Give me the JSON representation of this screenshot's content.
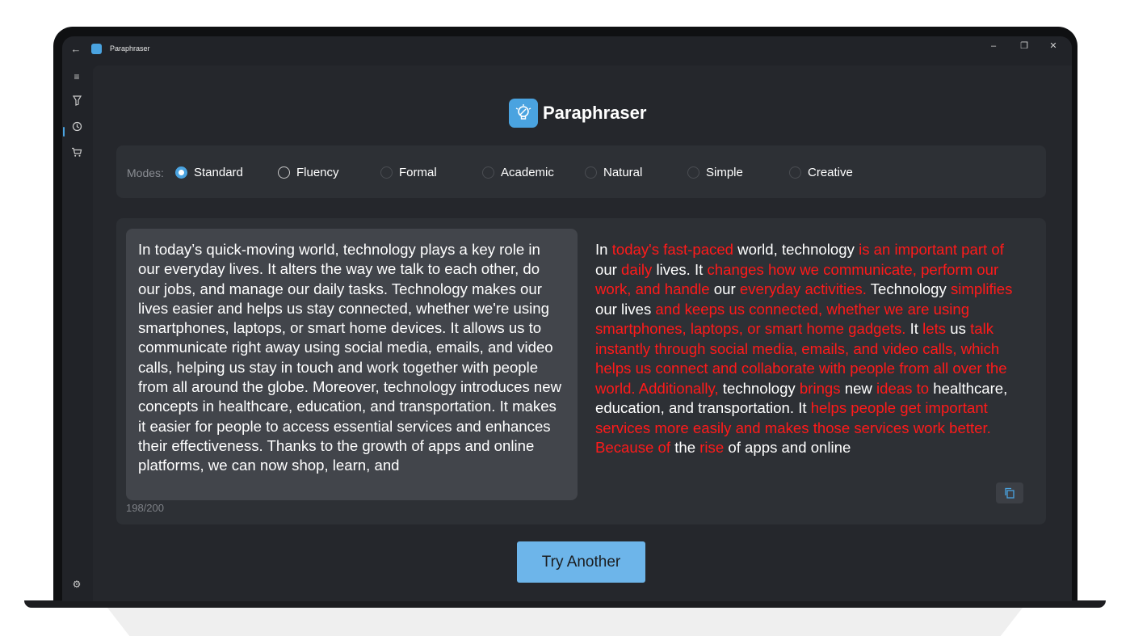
{
  "window": {
    "title": "Paraphraser",
    "back_symbol": "←",
    "minimize_symbol": "–",
    "restore_symbol": "❐",
    "close_symbol": "✕"
  },
  "sidebar": {
    "items": [
      {
        "name": "menu-icon",
        "symbol": "≡"
      },
      {
        "name": "paraphraser-icon",
        "symbol": "🜄"
      },
      {
        "name": "history-icon",
        "symbol": "⟲"
      },
      {
        "name": "cart-icon",
        "symbol": "🛒"
      }
    ],
    "settings_symbol": "⚙"
  },
  "header": {
    "title": "Paraphraser"
  },
  "modes": {
    "label": "Modes:",
    "options": [
      {
        "label": "Standard",
        "selected": true
      },
      {
        "label": "Fluency",
        "selected": false
      },
      {
        "label": "Formal",
        "selected": false
      },
      {
        "label": "Academic",
        "selected": false
      },
      {
        "label": "Natural",
        "selected": false
      },
      {
        "label": "Simple",
        "selected": false
      },
      {
        "label": "Creative",
        "selected": false
      }
    ]
  },
  "input": {
    "text": "In today’s quick-moving world, technology plays a key role in our everyday lives. It alters the way we talk to each other, do our jobs, and manage our daily tasks. Technology makes our lives easier and helps us stay connected, whether we're using smartphones, laptops, or smart home devices. It allows us to communicate right away using social media, emails, and video calls, helping us stay in touch and work together with people from all around the globe. Moreover, technology introduces new concepts in healthcare, education, and transportation. It makes it easier for people to access essential services and enhances their effectiveness. Thanks to the growth of apps and online platforms, we can now shop, learn, and",
    "counter": "198/200"
  },
  "output": {
    "segments": [
      {
        "t": "In ",
        "c": "w"
      },
      {
        "t": "today's fast-paced",
        "c": "r"
      },
      {
        "t": " world, technology ",
        "c": "w"
      },
      {
        "t": "is an important part of",
        "c": "r"
      },
      {
        "t": " our ",
        "c": "w"
      },
      {
        "t": "daily",
        "c": "r"
      },
      {
        "t": " lives. It ",
        "c": "w"
      },
      {
        "t": "changes how we communicate, perform our work, and handle",
        "c": "r"
      },
      {
        "t": " our ",
        "c": "w"
      },
      {
        "t": "everyday activities.",
        "c": "r"
      },
      {
        "t": " Technology ",
        "c": "w"
      },
      {
        "t": "simplifies",
        "c": "r"
      },
      {
        "t": " our lives ",
        "c": "w"
      },
      {
        "t": "and keeps us connected, whether we are using smartphones, laptops, or smart home gadgets.",
        "c": "r"
      },
      {
        "t": " It ",
        "c": "w"
      },
      {
        "t": "lets",
        "c": "r"
      },
      {
        "t": " us ",
        "c": "w"
      },
      {
        "t": "talk instantly through social media, emails, and video calls, which helps us connect and collaborate with people from all over the world. Additionally,",
        "c": "r"
      },
      {
        "t": " technology ",
        "c": "w"
      },
      {
        "t": "brings",
        "c": "r"
      },
      {
        "t": " new ",
        "c": "w"
      },
      {
        "t": "ideas to",
        "c": "r"
      },
      {
        "t": " healthcare, education, and transportation. It ",
        "c": "w"
      },
      {
        "t": "helps people get important services more easily and makes those services work better. Because of",
        "c": "r"
      },
      {
        "t": " the ",
        "c": "w"
      },
      {
        "t": "rise",
        "c": "r"
      },
      {
        "t": " of apps and online",
        "c": "w"
      }
    ]
  },
  "actions": {
    "try_another_label": "Try Another"
  },
  "colors": {
    "accent": "#4aa3e0",
    "button": "#6db5ea",
    "changed_text": "#ff1a1a"
  }
}
